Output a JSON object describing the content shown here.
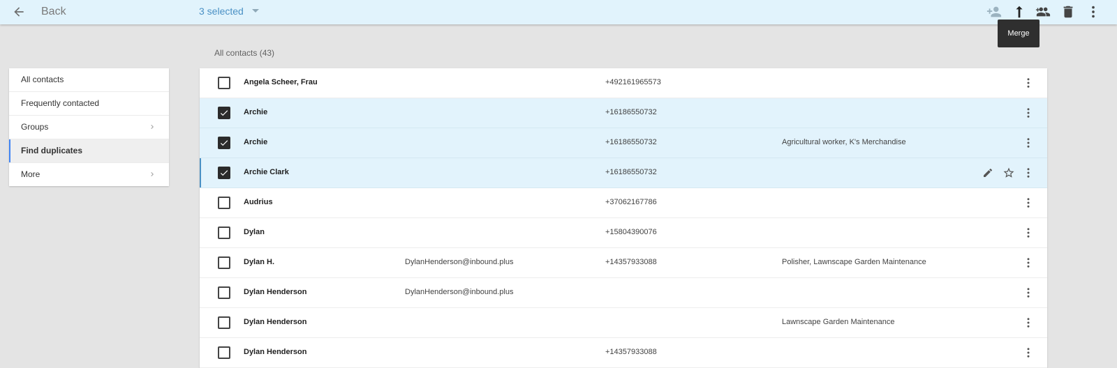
{
  "header": {
    "back_label": "Back",
    "selected_label": "3 selected",
    "tooltip": "Merge",
    "icons": [
      "arrow-back-icon",
      "add-person-icon",
      "merge-icon",
      "add-to-group-icon",
      "trash-icon",
      "more-vert-icon"
    ]
  },
  "list_heading": "All contacts (43)",
  "sidebar": {
    "items": [
      {
        "label": "All contacts"
      },
      {
        "label": "Frequently contacted"
      },
      {
        "label": "Groups"
      },
      {
        "label": "Find duplicates"
      },
      {
        "label": "More"
      }
    ]
  },
  "contacts": [
    {
      "name": "Angela Scheer, Frau",
      "email": "",
      "phone": "+492161965573",
      "org": "",
      "selected": false
    },
    {
      "name": "Archie",
      "email": "",
      "phone": "+16186550732",
      "org": "",
      "selected": true
    },
    {
      "name": "Archie",
      "email": "",
      "phone": "+16186550732",
      "org": "Agricultural worker, K's Merchandise",
      "selected": true
    },
    {
      "name": "Archie Clark",
      "email": "",
      "phone": "+16186550732",
      "org": "",
      "selected": true
    },
    {
      "name": "Audrius",
      "email": "",
      "phone": "+37062167786",
      "org": "",
      "selected": false
    },
    {
      "name": "Dylan",
      "email": "",
      "phone": "+15804390076",
      "org": "",
      "selected": false
    },
    {
      "name": "Dylan H.",
      "email": "DylanHenderson@inbound.plus",
      "phone": "+14357933088",
      "org": "Polisher, Lawnscape Garden Maintenance",
      "selected": false
    },
    {
      "name": "Dylan Henderson",
      "email": "DylanHenderson@inbound.plus",
      "phone": "",
      "org": "",
      "selected": false
    },
    {
      "name": "Dylan Henderson",
      "email": "",
      "phone": "",
      "org": "Lawnscape Garden Maintenance",
      "selected": false
    },
    {
      "name": "Dylan Henderson",
      "email": "",
      "phone": "+14357933088",
      "org": "",
      "selected": false
    }
  ],
  "colors": {
    "topbar": "#e1f3fc",
    "accent": "#4a90c4",
    "selected_row": "#e2f3fc",
    "background": "#e4e4e4"
  }
}
